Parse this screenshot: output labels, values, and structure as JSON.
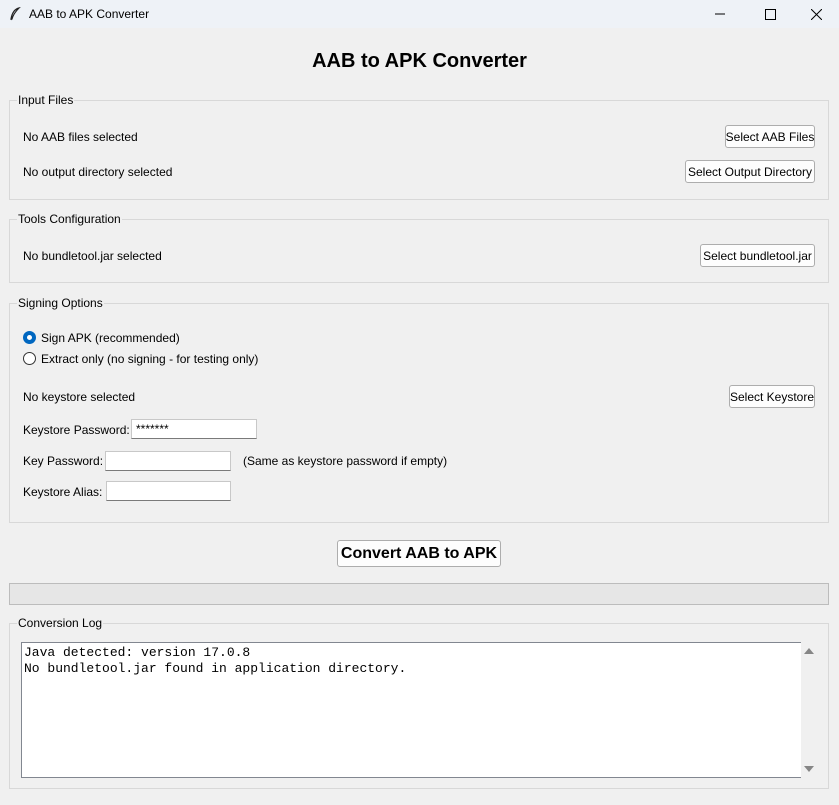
{
  "window": {
    "title": "AAB to APK Converter",
    "icon": "feather-icon"
  },
  "header": {
    "title": "AAB to APK Converter"
  },
  "input_files": {
    "label": "Input Files",
    "aab_status": "No AAB files selected",
    "aab_button": "Select AAB Files",
    "output_status": "No output directory selected",
    "output_button": "Select Output Directory"
  },
  "tools": {
    "label": "Tools Configuration",
    "bundletool_status": "No bundletool.jar selected",
    "bundletool_button": "Select bundletool.jar"
  },
  "signing": {
    "label": "Signing Options",
    "option_sign": "Sign APK (recommended)",
    "option_extract": "Extract only (no signing - for testing only)",
    "selected": "sign",
    "keystore_status": "No keystore selected",
    "keystore_button": "Select Keystore",
    "keystore_password_label": "Keystore Password:",
    "keystore_password_value": "*******",
    "key_password_label": "Key Password:",
    "key_password_value": "",
    "key_password_hint": "(Same as keystore password if empty)",
    "alias_label": "Keystore Alias:",
    "alias_value": ""
  },
  "convert_button": "Convert AAB to APK",
  "progress": 0,
  "log": {
    "label": "Conversion Log",
    "lines": [
      "Java detected: version 17.0.8",
      "No bundletool.jar found in application directory."
    ]
  },
  "colors": {
    "accent": "#0067c0",
    "background": "#f0f0f0"
  }
}
